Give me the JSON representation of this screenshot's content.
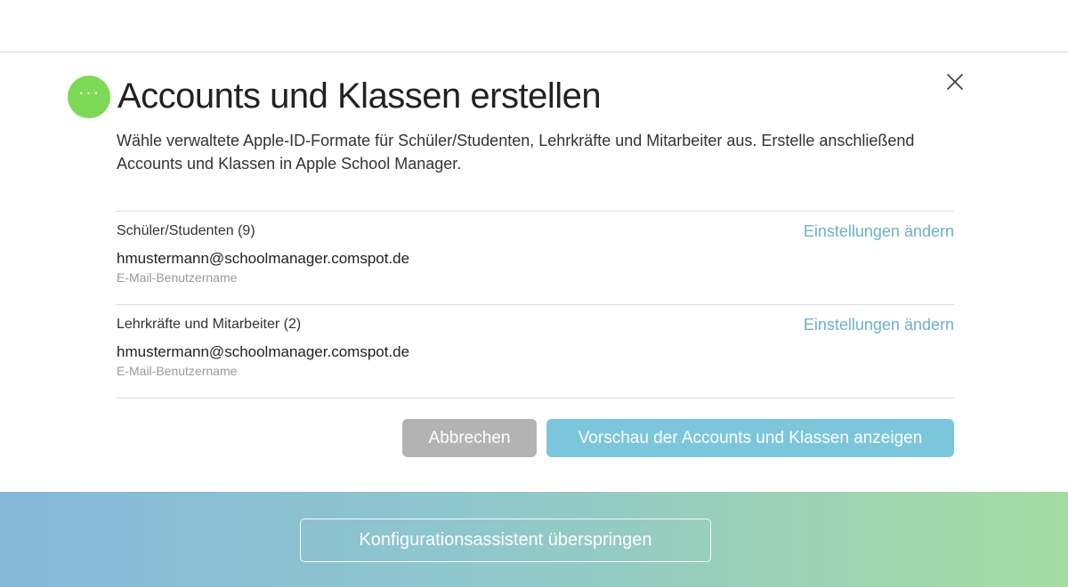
{
  "dialog": {
    "status_icon_glyph": "···",
    "title": "Accounts und Klassen erstellen",
    "description": "Wähle verwaltete Apple-ID-Formate für Schüler/Studenten, Lehrkräfte und Mitarbeiter aus. Erstelle anschließend Accounts und Klassen in Apple School Manager.",
    "sections": [
      {
        "title": "Schüler/Studenten (9)",
        "link": "Einstellungen ändern",
        "email": "hmustermann@schoolmanager.comspot.de",
        "subtitle": "E-Mail-Benutzername"
      },
      {
        "title": "Lehrkräfte und Mitarbeiter (2)",
        "link": "Einstellungen ändern",
        "email": "hmustermann@schoolmanager.comspot.de",
        "subtitle": "E-Mail-Benutzername"
      }
    ],
    "cancel_label": "Abbrechen",
    "primary_label": "Vorschau der Accounts und Klassen anzeigen"
  },
  "footer": {
    "skip_label": "Konfigurationsassistent überspringen"
  },
  "colors": {
    "status_green": "#7ed957",
    "link_blue": "#6fb1c8",
    "primary_button": "#7cc6dc",
    "cancel_button": "#b3b3b3"
  },
  "icons": {
    "status": "more-dots-icon",
    "close": "close-icon"
  }
}
